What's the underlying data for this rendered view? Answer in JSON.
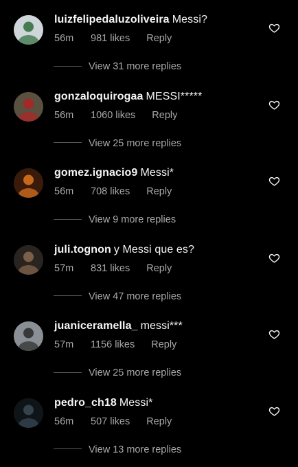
{
  "comments": [
    {
      "username": "luizfelipedaluzoliveira",
      "text": "Messi?",
      "time": "56m",
      "likes": "981 likes",
      "reply_label": "Reply",
      "view_replies": "View 31 more replies",
      "avatar_colors": [
        "#cfd6da",
        "#2e6b3a"
      ]
    },
    {
      "username": "gonzaloquirogaa",
      "text": "MESSI*****",
      "time": "56m",
      "likes": "1060 likes",
      "reply_label": "Reply",
      "view_replies": "View 25 more replies",
      "avatar_colors": [
        "#5a5040",
        "#b22222"
      ]
    },
    {
      "username": "gomez.ignacio9",
      "text": "Messi*",
      "time": "56m",
      "likes": "708 likes",
      "reply_label": "Reply",
      "view_replies": "View 9 more replies",
      "avatar_colors": [
        "#3a1a0a",
        "#e07820"
      ]
    },
    {
      "username": "juli.tognon",
      "text": "y Messi que es?",
      "time": "57m",
      "likes": "831 likes",
      "reply_label": "Reply",
      "view_replies": "View 47 more replies",
      "avatar_colors": [
        "#2a2420",
        "#8a6a50"
      ]
    },
    {
      "username": "juaniceramella_",
      "text": "messi***",
      "time": "57m",
      "likes": "1156 likes",
      "reply_label": "Reply",
      "view_replies": "View 25 more replies",
      "avatar_colors": [
        "#8a8f96",
        "#2a2a2a"
      ]
    },
    {
      "username": "pedro_ch18",
      "text": "Messi*",
      "time": "56m",
      "likes": "507 likes",
      "reply_label": "Reply",
      "view_replies": "View 13 more replies",
      "avatar_colors": [
        "#0e1418",
        "#3a4a55"
      ]
    }
  ]
}
